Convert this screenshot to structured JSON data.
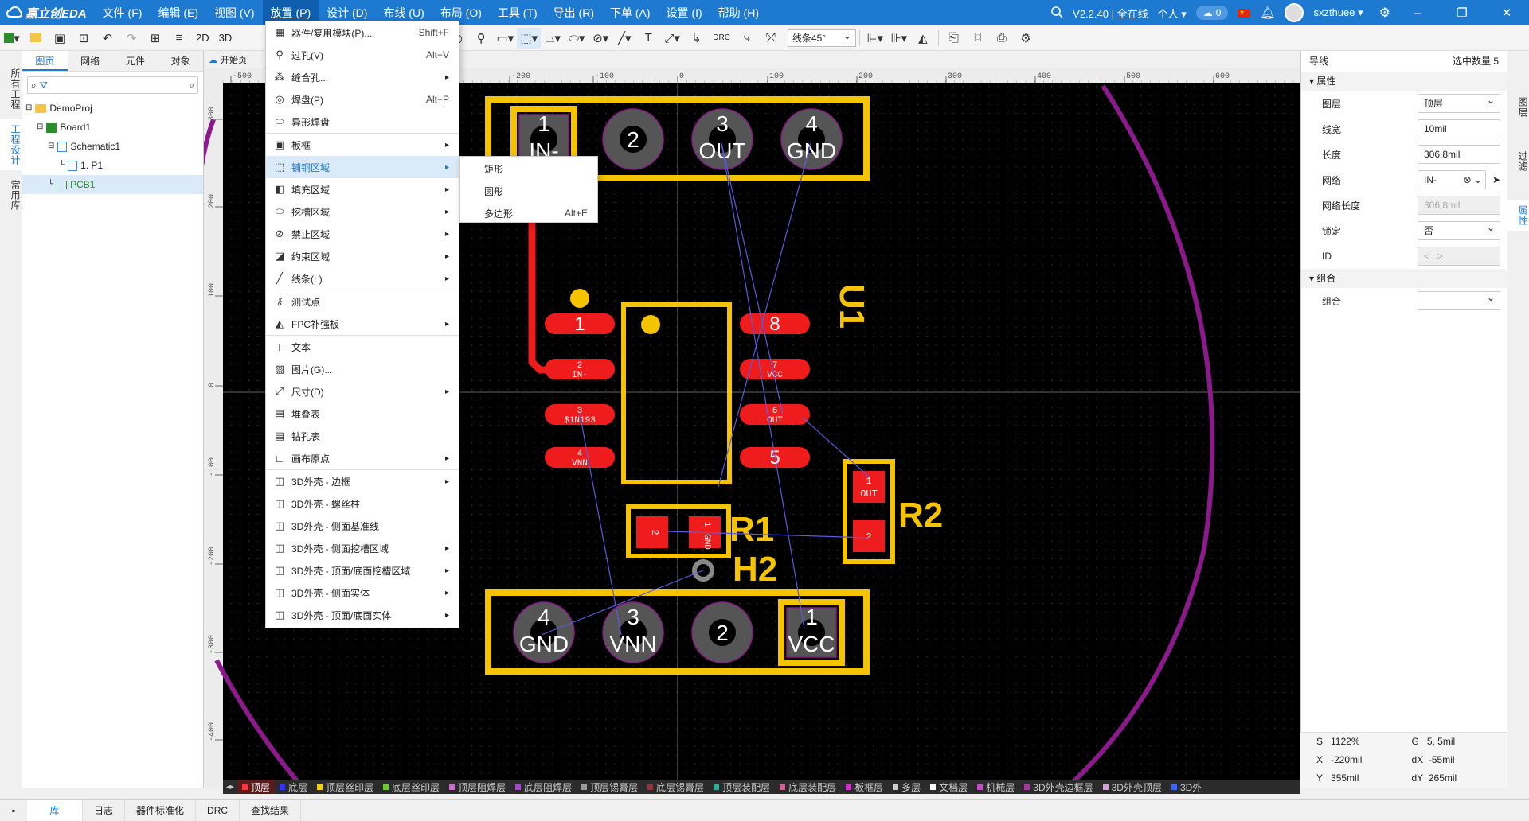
{
  "app": {
    "title": "嘉立创EDA",
    "version": "V2.2.40 | 全在线",
    "personal": "个人",
    "cloud_count": "0",
    "username": "sxzthuee"
  },
  "menubar": [
    "文件 (F)",
    "编辑 (E)",
    "视图 (V)",
    "放置 (P)",
    "设计 (D)",
    "布线 (U)",
    "布局 (O)",
    "工具 (T)",
    "导出 (R)",
    "下单 (A)",
    "设置 (I)",
    "帮助 (H)"
  ],
  "toolbar": {
    "view2d": "2D",
    "view3d": "3D",
    "drc": "DRC",
    "line_mode": "线条45°"
  },
  "left": {
    "vtabs": [
      "所有工程",
      "工程设计",
      "常用库"
    ],
    "tabs": [
      "图页",
      "网络",
      "元件",
      "对象"
    ],
    "tree": [
      {
        "label": "DemoProj",
        "type": "folder",
        "indent": 0
      },
      {
        "label": "Board1",
        "type": "board",
        "indent": 1
      },
      {
        "label": "Schematic1",
        "type": "schematic",
        "indent": 2
      },
      {
        "label": "1. P1",
        "type": "page",
        "indent": 3
      },
      {
        "label": "PCB1",
        "type": "pcb",
        "indent": 2,
        "selected": true
      }
    ]
  },
  "doctab": {
    "label": "开始页"
  },
  "ruler": {
    "x": [
      "-500",
      "-200",
      "-100",
      "0",
      "100",
      "200",
      "300",
      "400",
      "500",
      "600"
    ],
    "y": [
      "300",
      "200",
      "100",
      "0",
      "-100",
      "-200",
      "-300",
      "-400"
    ]
  },
  "place_menu": [
    {
      "label": "器件/复用模块(P)...",
      "icon": "chip-icon",
      "shortcut": "Shift+F"
    },
    {
      "label": "过孔(V)",
      "icon": "via-icon",
      "shortcut": "Alt+V"
    },
    {
      "label": "缝合孔...",
      "icon": "stitch-icon",
      "arrow": true
    },
    {
      "label": "焊盘(P)",
      "icon": "pad-icon",
      "shortcut": "Alt+P"
    },
    {
      "label": "异形焊盘",
      "icon": "shape-pad-icon",
      "sep": true
    },
    {
      "label": "板框",
      "icon": "board-frame-icon",
      "arrow": true
    },
    {
      "label": "铺铜区域",
      "icon": "copper-area-icon",
      "arrow": true,
      "highlight": true
    },
    {
      "label": "填充区域",
      "icon": "fill-area-icon",
      "arrow": true
    },
    {
      "label": "挖槽区域",
      "icon": "slot-area-icon",
      "arrow": true
    },
    {
      "label": "禁止区域",
      "icon": "keepout-icon",
      "arrow": true
    },
    {
      "label": "约束区域",
      "icon": "constraint-icon",
      "arrow": true
    },
    {
      "label": "线条(L)",
      "icon": "line-icon",
      "arrow": true,
      "sep": true
    },
    {
      "label": "测试点",
      "icon": "testpoint-icon"
    },
    {
      "label": "FPC补强板",
      "icon": "fpc-icon",
      "arrow": true,
      "sep": true
    },
    {
      "label": "文本",
      "icon": "text-icon"
    },
    {
      "label": "图片(G)...",
      "icon": "image-icon"
    },
    {
      "label": "尺寸(D)",
      "icon": "dimension-icon",
      "arrow": true
    },
    {
      "label": "堆叠表",
      "icon": "stackup-table-icon"
    },
    {
      "label": "钻孔表",
      "icon": "drill-table-icon"
    },
    {
      "label": "画布原点",
      "icon": "origin-icon",
      "arrow": true,
      "sep": true
    },
    {
      "label": "3D外壳 - 边框",
      "icon": "shell-icon",
      "arrow": true
    },
    {
      "label": "3D外壳 - 螺丝柱",
      "icon": "shell-icon"
    },
    {
      "label": "3D外壳 - 侧面基准线",
      "icon": "shell-icon"
    },
    {
      "label": "3D外壳 - 侧面挖槽区域",
      "icon": "shell-icon",
      "arrow": true
    },
    {
      "label": "3D外壳 - 顶面/底面挖槽区域",
      "icon": "shell-icon",
      "arrow": true
    },
    {
      "label": "3D外壳 - 侧面实体",
      "icon": "shell-icon",
      "arrow": true
    },
    {
      "label": "3D外壳 - 顶面/底面实体",
      "icon": "shell-icon",
      "arrow": true
    }
  ],
  "submenu": [
    {
      "label": "矩形"
    },
    {
      "label": "圆形"
    },
    {
      "label": "多边形",
      "shortcut": "Alt+E"
    }
  ],
  "pcb": {
    "connectors": [
      {
        "pins": [
          {
            "n": "1",
            "net": "IN-"
          },
          {
            "n": "2",
            "net": ""
          },
          {
            "n": "3",
            "net": "OUT"
          },
          {
            "n": "4",
            "net": "GND"
          }
        ]
      },
      {
        "pins": [
          {
            "n": "4",
            "net": "GND"
          },
          {
            "n": "3",
            "net": "VNN"
          },
          {
            "n": "2",
            "net": ""
          },
          {
            "n": "1",
            "net": "VCC"
          }
        ]
      }
    ],
    "u1_left": [
      {
        "n": "1",
        "net": ""
      },
      {
        "n": "2",
        "net": "IN-"
      },
      {
        "n": "3",
        "net": "$1N193"
      },
      {
        "n": "4",
        "net": "VNN"
      }
    ],
    "u1_right": [
      {
        "n": "8",
        "net": ""
      },
      {
        "n": "7",
        "net": "VCC"
      },
      {
        "n": "6",
        "net": "OUT"
      },
      {
        "n": "5",
        "net": ""
      }
    ],
    "labels": {
      "u1": "U1",
      "r1": "R1",
      "r2": "R2",
      "h2": "H2"
    },
    "r1_pads": [
      {
        "n": "2",
        "net": ""
      },
      {
        "n": "1",
        "net": "GND"
      }
    ],
    "r2_pads": [
      {
        "n": "1",
        "net": "OUT"
      },
      {
        "n": "2",
        "net": ""
      }
    ]
  },
  "right": {
    "header_left": "导线",
    "header_right": "选中数量  5",
    "vtabs": [
      "图层",
      "过滤",
      "属性"
    ],
    "section_props": "属性",
    "props": [
      {
        "label": "图层",
        "value": "顶层",
        "kind": "dropdown"
      },
      {
        "label": "线宽",
        "value": "10mil",
        "kind": "input"
      },
      {
        "label": "长度",
        "value": "306.8mil",
        "kind": "input"
      },
      {
        "label": "网络",
        "value": "IN-",
        "kind": "net"
      },
      {
        "label": "网络长度",
        "value": "306.8mil",
        "kind": "disabled"
      },
      {
        "label": "锁定",
        "value": "否",
        "kind": "dropdown"
      },
      {
        "label": "ID",
        "value": "<...>",
        "kind": "disabled"
      }
    ],
    "section_group": "组合",
    "group_label": "组合",
    "group_value": ""
  },
  "coords": {
    "s": "1122%",
    "g": "5, 5mil",
    "x": "-220mil",
    "dx": "-55mil",
    "y": "355mil",
    "dy": "265mil"
  },
  "layers": [
    {
      "name": "顶层",
      "color": "#ff3333",
      "active": true
    },
    {
      "name": "底层",
      "color": "#3333ff"
    },
    {
      "name": "顶层丝印层",
      "color": "#ffcc00"
    },
    {
      "name": "底层丝印层",
      "color": "#66cc33"
    },
    {
      "name": "顶层阻焊层",
      "color": "#cc66cc"
    },
    {
      "name": "底层阻焊层",
      "color": "#aa44cc"
    },
    {
      "name": "顶层锡膏层",
      "color": "#999999"
    },
    {
      "name": "底层锡膏层",
      "color": "#993333"
    },
    {
      "name": "顶层装配层",
      "color": "#33aa99"
    },
    {
      "name": "底层装配层",
      "color": "#cc6699"
    },
    {
      "name": "板框层",
      "color": "#cc33cc"
    },
    {
      "name": "多层",
      "color": "#cccccc"
    },
    {
      "name": "文档层",
      "color": "#ffffff"
    },
    {
      "name": "机械层",
      "color": "#cc44cc"
    },
    {
      "name": "3D外壳边框层",
      "color": "#aa33aa"
    },
    {
      "name": "3D外壳顶层",
      "color": "#dd99dd"
    },
    {
      "name": "3D外",
      "color": "#3366ff"
    }
  ],
  "bottom_tabs": [
    "库",
    "日志",
    "器件标准化",
    "DRC",
    "查找结果"
  ]
}
